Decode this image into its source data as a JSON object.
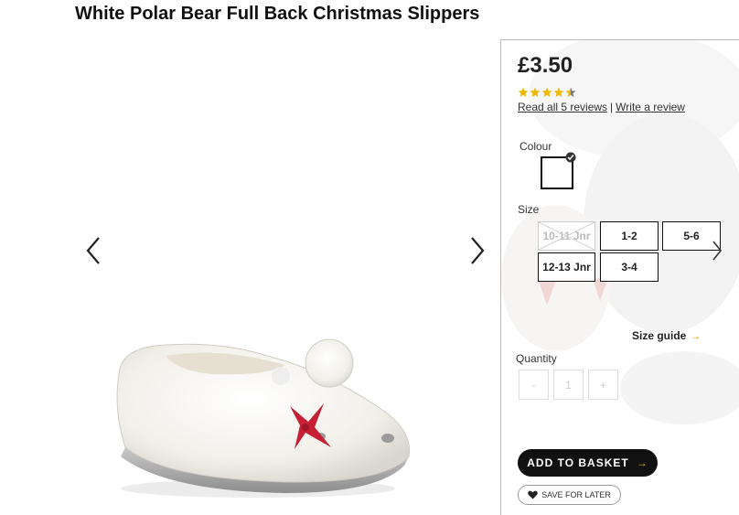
{
  "product": {
    "title": "White Polar Bear Full Back Christmas Slippers"
  },
  "gallery": {
    "prev_icon": "chevron-left-icon",
    "next_icon": "chevron-right-icon"
  },
  "purchase": {
    "price": "£3.50",
    "rating": 4.5,
    "rating_max": 5,
    "read_reviews_label": "Read all 5 reviews",
    "separator": "|",
    "write_review_label": "Write a review",
    "colour_label": "Colour",
    "size_label": "Size",
    "sizes": [
      {
        "label": "10-11 Jnr",
        "available": false
      },
      {
        "label": "1-2",
        "available": true
      },
      {
        "label": "5-6",
        "available": true
      },
      {
        "label": "12-13 Jnr",
        "available": true
      },
      {
        "label": "3-4",
        "available": true
      }
    ],
    "size_guide_label": "Size guide",
    "quantity_label": "Quantity",
    "quantity": {
      "minus": "-",
      "value": "1",
      "plus": "+"
    },
    "add_to_basket_label": "ADD TO BASKET",
    "save_for_later_label": "SAVE FOR LATER"
  },
  "colors": {
    "star": "#f0b800",
    "button_bg": "#111111",
    "accent": "#f2b400"
  }
}
